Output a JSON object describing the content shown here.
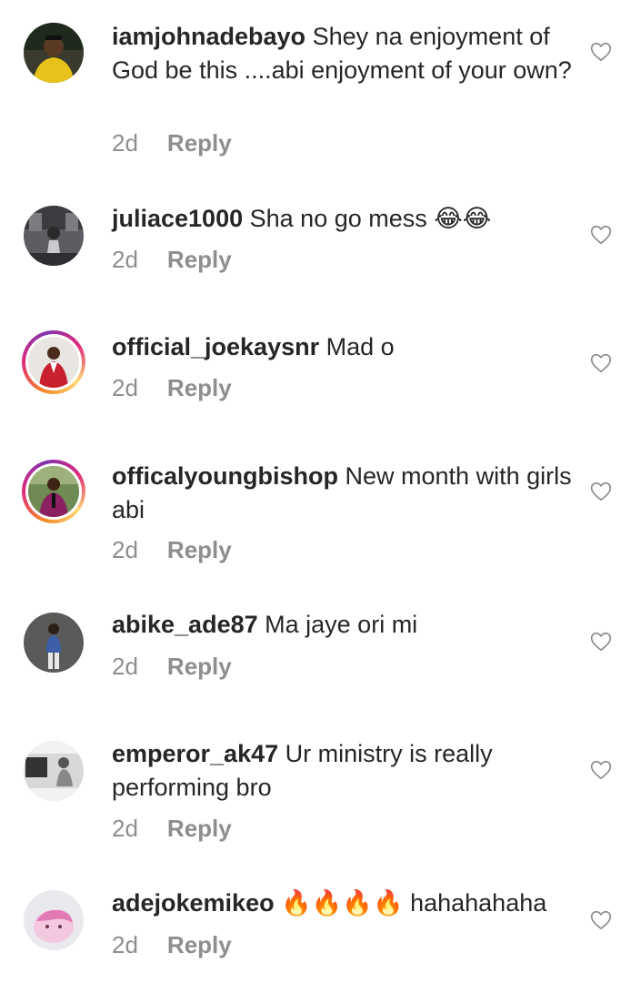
{
  "comments": [
    {
      "username": "iamjohnadebayo",
      "text": "Shey na enjoyment of God be this ....abi enjoyment of your own?",
      "time": "2d",
      "reply": "Reply",
      "avatar": {
        "bg": "#3a3a2e",
        "accent": "#e7c21a",
        "story_ring": false
      }
    },
    {
      "username": "juliace1000",
      "text": "Sha no go mess 😂😂",
      "time": "2d",
      "reply": "Reply",
      "avatar": {
        "bg": "#5b5d63",
        "accent": "#c9c9cf",
        "story_ring": false
      }
    },
    {
      "username": "official_joekaysnr",
      "text": "Mad o",
      "time": "2d",
      "reply": "Reply",
      "avatar": {
        "bg": "#e9e6e2",
        "accent": "#c8202e",
        "story_ring": true
      }
    },
    {
      "username": "officalyoungbishop",
      "text": "New month with girls abi",
      "time": "2d",
      "reply": "Reply",
      "avatar": {
        "bg": "#6f8a52",
        "accent": "#8a2060",
        "story_ring": true
      }
    },
    {
      "username": "abike_ade87",
      "text": "Ma jaye ori mi",
      "time": "2d",
      "reply": "Reply",
      "avatar": {
        "bg": "#5a5a58",
        "accent": "#3c5fa8",
        "story_ring": false
      }
    },
    {
      "username": "emperor_ak47",
      "text": "Ur ministry is really performing bro",
      "time": "2d",
      "reply": "Reply",
      "avatar": {
        "bg": "#d8d8d8",
        "accent": "#333333",
        "story_ring": false
      }
    },
    {
      "username": "adejokemikeo",
      "text": "🔥🔥🔥🔥 hahahahaha",
      "time": "2d",
      "reply": "Reply",
      "avatar": {
        "bg": "#e9e9ee",
        "accent": "#e27ab6",
        "story_ring": false
      }
    }
  ],
  "icons": {
    "like": "heart-outline-icon"
  },
  "colors": {
    "text": "#262626",
    "muted": "#8e8e8e",
    "heart": "#8e8e8e"
  }
}
